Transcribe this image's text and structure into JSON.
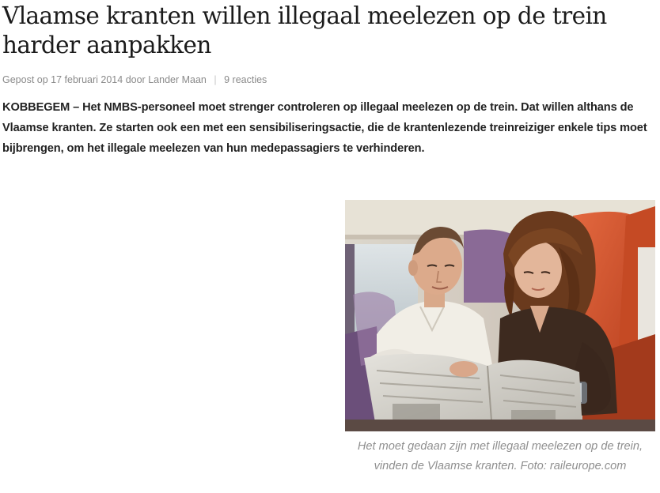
{
  "article": {
    "title": "Vlaamse kranten willen illegaal meelezen op de trein harder aanpakken",
    "meta": {
      "posted_prefix": "Gepost op",
      "date": "17 februari 2014",
      "by": "door",
      "author": "Lander Maan",
      "separator": "|",
      "comments": "9 reacties"
    },
    "lead": "KOBBEGEM – Het NMBS-personeel moet strenger controleren op illegaal meelezen op de trein. Dat willen althans de Vlaamse kranten. Ze starten ook een met een sensibiliseringsactie, die de krantenlezende treinreiziger enkele tips moet bijbrengen, om het illegale meelezen van hun medepassagiers te verhinderen.",
    "figure": {
      "caption": "Het moet gedaan zijn met illegaal meelezen op de trein, vinden de Vlaamse kranten. Foto: raileurope.com"
    }
  }
}
